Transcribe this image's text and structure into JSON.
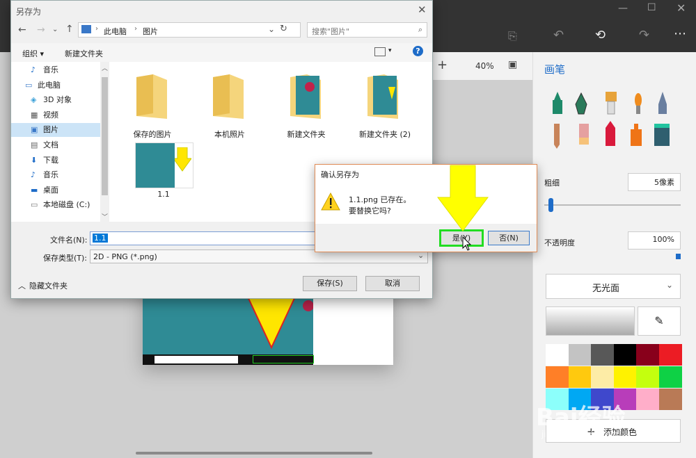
{
  "save_dialog": {
    "title": "另存为",
    "breadcrumb": [
      "此电脑",
      "图片"
    ],
    "search_placeholder": "搜索\"图片\"",
    "organize": "组织 ▾",
    "new_folder": "新建文件夹",
    "tree": [
      {
        "label": "音乐",
        "icon": "music-note-icon"
      },
      {
        "label": "此电脑",
        "icon": "computer-icon"
      },
      {
        "label": "3D 对象",
        "icon": "cube-icon"
      },
      {
        "label": "视频",
        "icon": "video-icon"
      },
      {
        "label": "图片",
        "icon": "picture-icon",
        "selected": true
      },
      {
        "label": "文档",
        "icon": "document-icon"
      },
      {
        "label": "下载",
        "icon": "download-icon"
      },
      {
        "label": "音乐",
        "icon": "music-note-icon"
      },
      {
        "label": "桌面",
        "icon": "desktop-icon"
      },
      {
        "label": "本地磁盘 (C:)",
        "icon": "drive-icon"
      }
    ],
    "files": [
      "保存的图片",
      "本机照片",
      "新建文件夹",
      "新建文件夹 (2)",
      "1.1"
    ],
    "filename_label": "文件名(N):",
    "filename_value": "1.1",
    "filetype_label": "保存类型(T):",
    "filetype_value": "2D - PNG (*.png)",
    "hide_folders": "隐藏文件夹",
    "save_button": "保存(S)",
    "cancel_button": "取消"
  },
  "confirm_dialog": {
    "title": "确认另存为",
    "message_line1": "1.1.png 已存在。",
    "message_line2": "要替换它吗?",
    "yes_button": "是(Y)",
    "no_button": "否(N)"
  },
  "app": {
    "zoom": "40%",
    "panel_title": "画笔",
    "thickness_label": "粗细",
    "thickness_value": "5像素",
    "opacity_label": "不透明度",
    "opacity_value": "100%",
    "finish_dropdown": "无光面",
    "add_color": "添加颜色",
    "palette": [
      "#ffffff",
      "#c3c3c3",
      "#585858",
      "#000000",
      "#88001b",
      "#ec1c24",
      "#ff7f27",
      "#ffc90e",
      "#fdeca6",
      "#fff200",
      "#c4ff0e",
      "#0ed145",
      "#8cfffb",
      "#00a8f3",
      "#3f48cc",
      "#b83dba",
      "#ffaec9",
      "#b97a56"
    ]
  },
  "watermark": {
    "text": "Bai经验",
    "sub": "jingyan.baidu.com"
  }
}
